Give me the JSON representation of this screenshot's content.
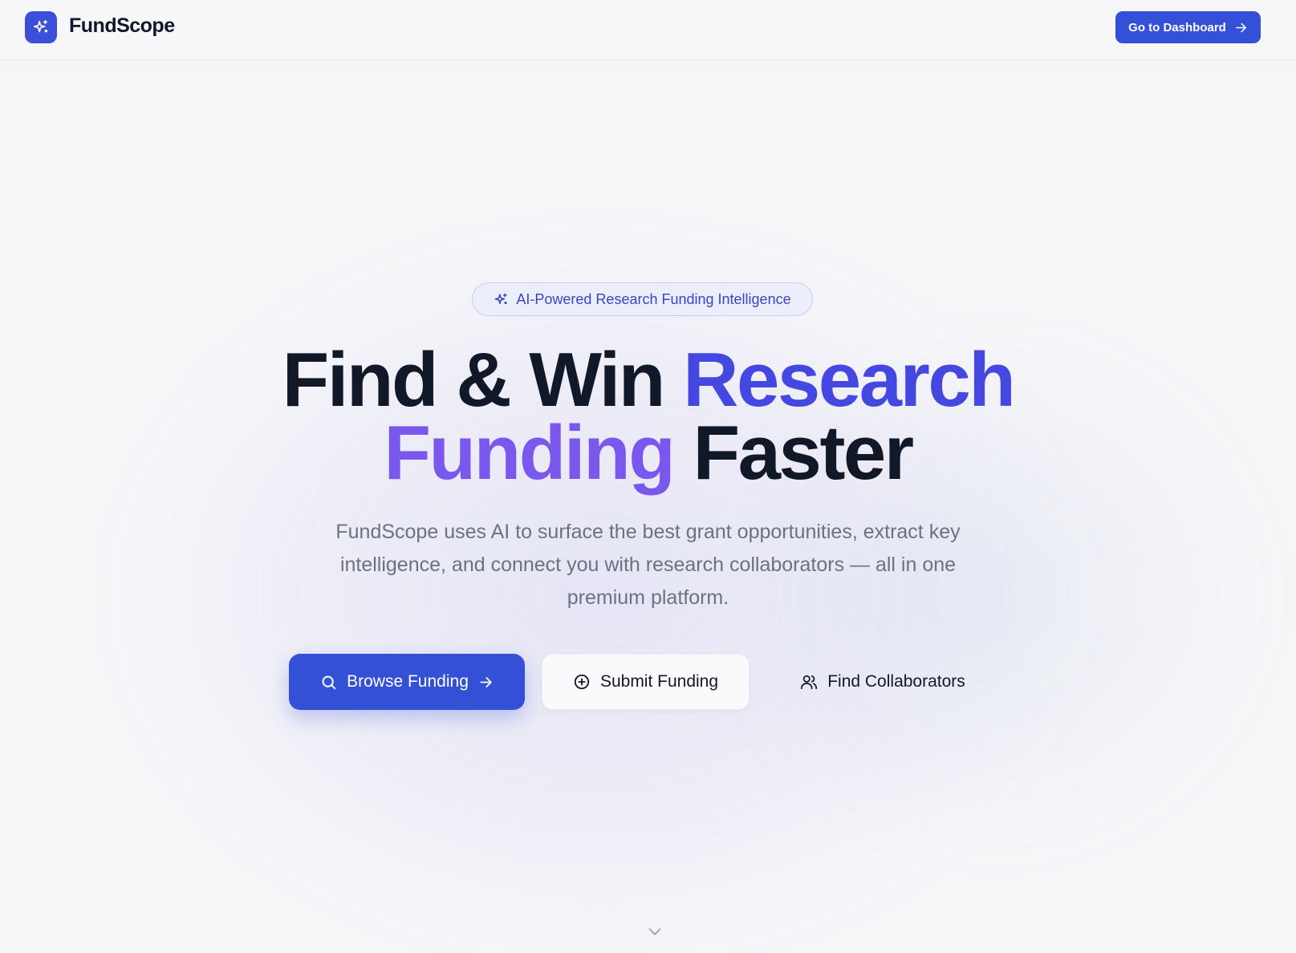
{
  "header": {
    "brand_name": "FundScope",
    "dashboard_label": "Go to Dashboard"
  },
  "hero": {
    "badge_text": "AI-Powered Research Funding Intelligence",
    "headline": {
      "part1": "Find & Win ",
      "highlight1": "Research",
      "highlight2": "Funding",
      "part2": " Faster"
    },
    "subtitle_lines": [
      "FundScope uses AI to surface the best grant opportunities, extract key",
      "intelligence, and connect you with research collaborators — all in one",
      "premium platform."
    ],
    "buttons": {
      "browse": "Browse Funding",
      "submit": "Submit Funding",
      "collaborators": "Find Collaborators"
    }
  },
  "icons": {
    "logo": "sparkles-icon",
    "dashboard": "arrow-right-icon",
    "badge": "sparkles-icon",
    "browse": "search-icon",
    "browse_trailing": "arrow-right-icon",
    "submit": "plus-circle-icon",
    "collaborators": "users-icon",
    "scroll": "chevron-down-icon"
  },
  "colors": {
    "primary": "#3450d6",
    "headline_highlight_1": "#4548e0",
    "headline_highlight_2": "#7a58ee",
    "text_dark": "#111827",
    "text_muted": "#6b7280",
    "background": "#f6f6f9"
  }
}
